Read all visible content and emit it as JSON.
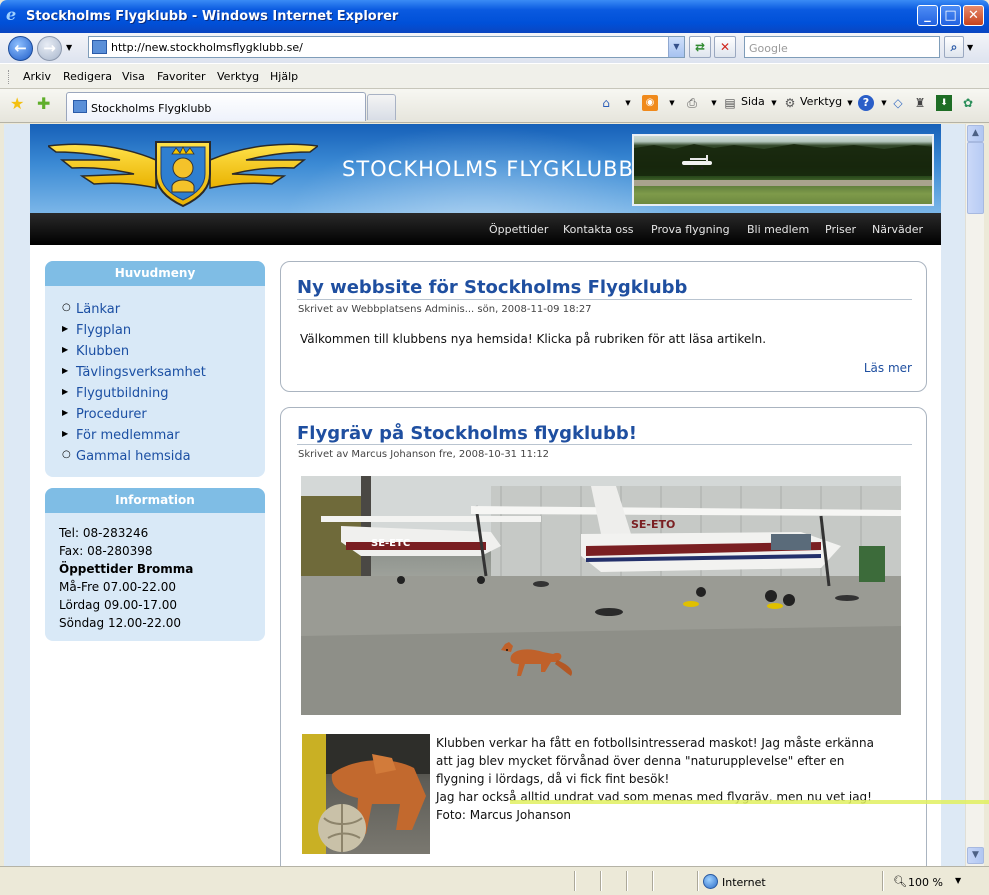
{
  "window": {
    "title": "Stockholms Flygklubb - Windows Internet Explorer"
  },
  "address": {
    "url": "http://new.stockholmsflygklubb.se/",
    "search_placeholder": "Google"
  },
  "menubar": [
    "Arkiv",
    "Redigera",
    "Visa",
    "Favoriter",
    "Verktyg",
    "Hjälp"
  ],
  "tab": {
    "label": "Stockholms Flygklubb"
  },
  "toolbar": {
    "page_label": "Sida",
    "tools_label": "Verktyg"
  },
  "site": {
    "name": "STOCKHOLMS FLYGKLUBB",
    "nav": [
      "Öppettider",
      "Kontakta oss",
      "Prova flygning",
      "Bli medlem",
      "Priser",
      "Närväder"
    ],
    "main_menu": {
      "title": "Huvudmeny",
      "items": [
        "Länkar",
        "Flygplan",
        "Klubben",
        "Tävlingsverksamhet",
        "Flygutbildning",
        "Procedurer",
        "För medlemmar",
        "Gammal hemsida"
      ]
    },
    "info": {
      "title": "Information",
      "lines": [
        "Tel: 08-283246",
        "Fax: 08-280398",
        "Öppettider Bromma",
        "Må-Fre 07.00-22.00",
        "Lördag 09.00-17.00",
        "Söndag 12.00-22.00"
      ]
    },
    "articles": [
      {
        "title": "Ny webbsite för Stockholms Flygklubb",
        "meta": "Skrivet av Webbplatsens Adminis... sön, 2008-11-09 18:27",
        "body": "Välkommen till klubbens nya hemsida! Klicka på rubriken för att läsa artikeln.",
        "read_more": "Läs mer"
      },
      {
        "title": "Flygräv på Stockholms flygklubb!",
        "meta": "Skrivet av Marcus Johanson fre, 2008-10-31 11:12",
        "photo_labels": [
          "SE-ETO",
          "SE-ETC"
        ],
        "paragraphs": [
          "Klubben verkar ha fått en fotbollsintresserad maskot! Jag måste erkänna",
          "att jag blev mycket förvånad över denna \"naturupplevelse\" efter en",
          "flygning i lördags, då vi fick fint besök!",
          "Jag har också alltid undrat vad som menas med flygräv, men nu vet jag!",
          "Foto: Marcus Johanson"
        ]
      }
    ]
  },
  "status": {
    "zone": "Internet",
    "zoom": "100 %"
  },
  "colors": {
    "title_blue": "#1f4fa0",
    "box_header": "#7fbde5",
    "box_bg": "#d9e9f7",
    "nav_bg": "#000000"
  }
}
